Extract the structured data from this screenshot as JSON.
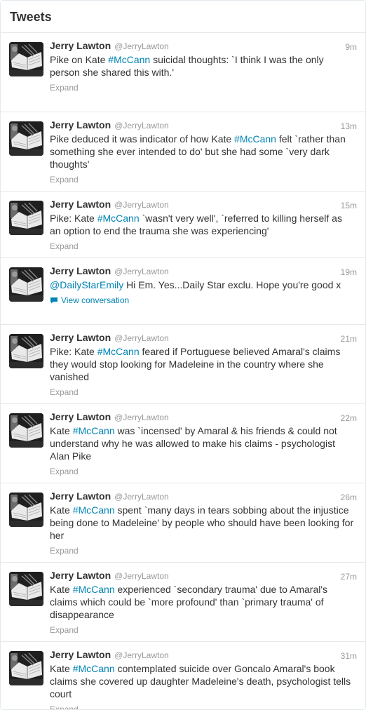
{
  "header": {
    "title": "Tweets"
  },
  "colors": {
    "link": "#0084b4",
    "muted": "#999999",
    "text": "#333333"
  },
  "tweets": [
    {
      "name": "Jerry Lawton",
      "handle": "@JerryLawton",
      "time": "9m",
      "parts": [
        {
          "t": "Pike on Kate ",
          "k": "text"
        },
        {
          "t": "#McCann",
          "k": "hashtag"
        },
        {
          "t": " suicidal thoughts: `I think I was the only person she shared this with.'",
          "k": "text"
        }
      ],
      "action": "Expand",
      "action_type": "expand",
      "height": 113
    },
    {
      "name": "Jerry Lawton",
      "handle": "@JerryLawton",
      "time": "13m",
      "parts": [
        {
          "t": "Pike deduced it was indicator of how Kate ",
          "k": "text"
        },
        {
          "t": "#McCann",
          "k": "hashtag"
        },
        {
          "t": " felt `rather than something she ever intended to do' but she had some `very dark thoughts'",
          "k": "text"
        }
      ],
      "action": "Expand",
      "action_type": "expand",
      "height": 113
    },
    {
      "name": "Jerry Lawton",
      "handle": "@JerryLawton",
      "time": "15m",
      "parts": [
        {
          "t": "Pike: Kate ",
          "k": "text"
        },
        {
          "t": "#McCann",
          "k": "hashtag"
        },
        {
          "t": " `wasn't very well', `referred to killing herself as an option to end the trauma she was experiencing'",
          "k": "text"
        }
      ],
      "action": "Expand",
      "action_type": "expand",
      "height": 95
    },
    {
      "name": "Jerry Lawton",
      "handle": "@JerryLawton",
      "time": "19m",
      "parts": [
        {
          "t": "@DailyStarEmily",
          "k": "mention"
        },
        {
          "t": " Hi Em. Yes...Daily Star exclu. Hope you're good x",
          "k": "text"
        }
      ],
      "action": "View conversation",
      "action_type": "conversation",
      "height": 95
    },
    {
      "name": "Jerry Lawton",
      "handle": "@JerryLawton",
      "time": "21m",
      "parts": [
        {
          "t": "Pike: Kate ",
          "k": "text"
        },
        {
          "t": "#McCann",
          "k": "hashtag"
        },
        {
          "t": " feared if Portuguese believed Amaral's claims they would stop looking for Madeleine in the country where she vanished",
          "k": "text"
        }
      ],
      "action": "Expand",
      "action_type": "expand",
      "height": 113
    },
    {
      "name": "Jerry Lawton",
      "handle": "@JerryLawton",
      "time": "22m",
      "parts": [
        {
          "t": "Kate ",
          "k": "text"
        },
        {
          "t": "#McCann",
          "k": "hashtag"
        },
        {
          "t": " was `incensed' by Amaral & his friends & could not understand why he was allowed to make his claims - psychologist Alan Pike",
          "k": "text"
        }
      ],
      "action": "Expand",
      "action_type": "expand",
      "height": 113
    },
    {
      "name": "Jerry Lawton",
      "handle": "@JerryLawton",
      "time": "26m",
      "parts": [
        {
          "t": "Kate ",
          "k": "text"
        },
        {
          "t": "#McCann",
          "k": "hashtag"
        },
        {
          "t": " spent `many days in tears sobbing about the injustice being done to Madeleine' by people who should have been looking for her",
          "k": "text"
        }
      ],
      "action": "Expand",
      "action_type": "expand",
      "height": 113
    },
    {
      "name": "Jerry Lawton",
      "handle": "@JerryLawton",
      "time": "27m",
      "parts": [
        {
          "t": "Kate ",
          "k": "text"
        },
        {
          "t": "#McCann",
          "k": "hashtag"
        },
        {
          "t": " experienced `secondary trauma' due to Amaral's claims which could be `more profound' than `primary trauma' of disappearance",
          "k": "text"
        }
      ],
      "action": "Expand",
      "action_type": "expand",
      "height": 113
    },
    {
      "name": "Jerry Lawton",
      "handle": "@JerryLawton",
      "time": "31m",
      "parts": [
        {
          "t": "Kate ",
          "k": "text"
        },
        {
          "t": "#McCann",
          "k": "hashtag"
        },
        {
          "t": " contemplated suicide over Goncalo Amaral's book claims she covered up daughter Madeleine's death, psychologist tells court",
          "k": "text"
        }
      ],
      "action": "Expand",
      "action_type": "expand",
      "height": 113
    }
  ]
}
